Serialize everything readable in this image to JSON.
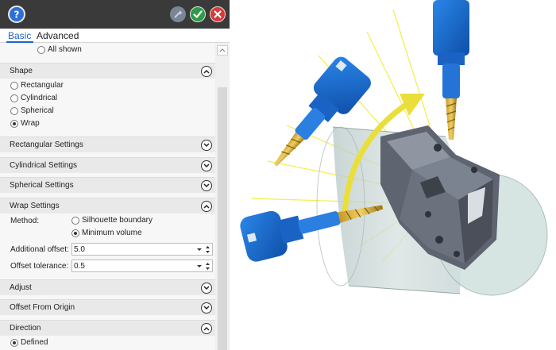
{
  "tabs": {
    "basic": "Basic",
    "advanced": "Advanced"
  },
  "toolbar": {
    "help_icon": "help-icon",
    "magic_icon": "wand-icon",
    "ok_icon": "checkmark-icon",
    "cancel_icon": "close-icon",
    "colors": {
      "help": "#2d6fd6",
      "ok": "#2f9a4a",
      "cancel": "#d63a3a",
      "tab_active": "#1e63c8"
    }
  },
  "top_option": {
    "label": "All shown",
    "selected": false
  },
  "shape": {
    "title": "Shape",
    "expanded": true,
    "options": [
      {
        "label": "Rectangular",
        "selected": false
      },
      {
        "label": "Cylindrical",
        "selected": false
      },
      {
        "label": "Spherical",
        "selected": false
      },
      {
        "label": "Wrap",
        "selected": true
      }
    ]
  },
  "sections": {
    "rectangular": "Rectangular Settings",
    "cylindrical": "Cylindrical Settings",
    "spherical": "Spherical Settings",
    "adjust": "Adjust",
    "offset_origin": "Offset From Origin"
  },
  "wrap": {
    "title": "Wrap Settings",
    "expanded": true,
    "method_label": "Method:",
    "methods": [
      {
        "label": "Silhouette boundary",
        "selected": false
      },
      {
        "label": "Minimum volume",
        "selected": true
      }
    ],
    "additional_offset_label": "Additional offset:",
    "additional_offset_value": "5.0",
    "offset_tolerance_label": "Offset tolerance:",
    "offset_tolerance_value": "0.5"
  },
  "direction": {
    "title": "Direction",
    "expanded": true,
    "options": [
      {
        "label": "Defined",
        "selected": true
      }
    ]
  }
}
